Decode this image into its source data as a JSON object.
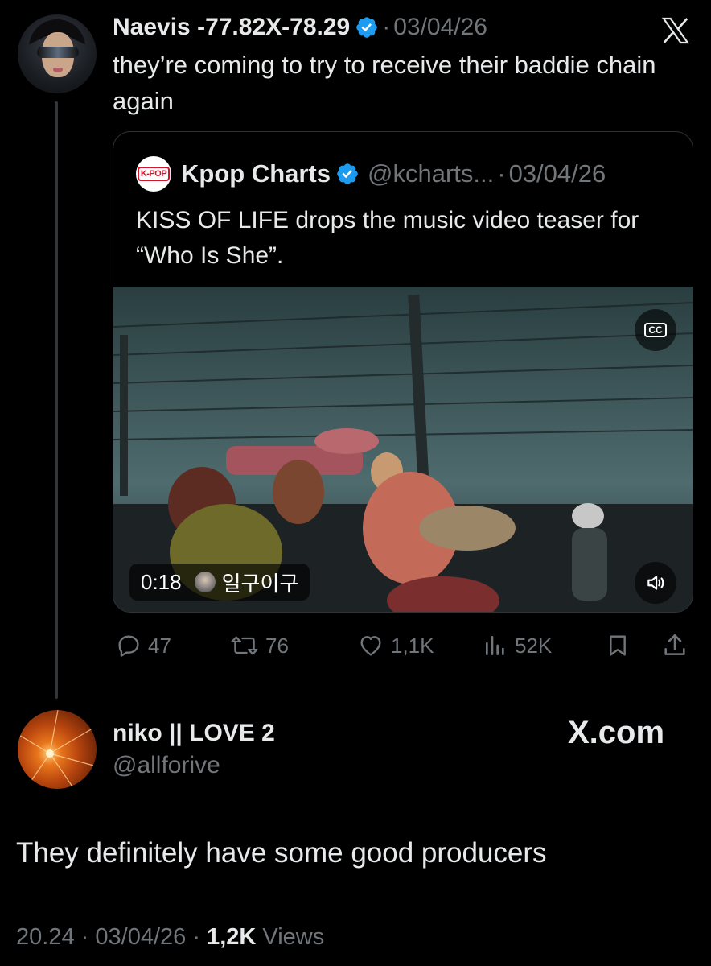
{
  "tweet1": {
    "display_name": "Naevis -77.82X-78.29",
    "date_separator": "·",
    "date": "03/04/26",
    "text": "they’re coming to try to receive their baddie chain again",
    "platform_icon": "x-logo-icon"
  },
  "quote": {
    "avatar_text": "K-POP",
    "display_name": "Kpop Charts",
    "handle": "@kcharts...",
    "date_separator": "·",
    "date": "03/04/26",
    "text": "KISS OF LIFE drops the music video teaser for “Who Is She”.",
    "video": {
      "cc_label": "CC",
      "duration": "0:18",
      "uploader": "일구이구",
      "volume_icon": "volume-icon"
    }
  },
  "actions": {
    "replies": "47",
    "reposts": "76",
    "likes": "1,1K",
    "views": "52K",
    "icons": [
      "reply-icon",
      "repost-icon",
      "like-icon",
      "views-icon",
      "bookmark-icon",
      "share-icon"
    ]
  },
  "tweet2": {
    "display_name": "niko || LOVE 2",
    "handle": "@allforive",
    "watermark": "X.com",
    "text": "They definitely have some good producers",
    "time": "20.24",
    "sep1": "·",
    "date": "03/04/26",
    "sep2": "·",
    "views_count": "1,2K",
    "views_label": "Views"
  },
  "colors": {
    "background": "#000000",
    "text": "#e7e9ea",
    "muted": "#71767b",
    "verified": "#1d9bf0",
    "border": "#2f3336"
  }
}
